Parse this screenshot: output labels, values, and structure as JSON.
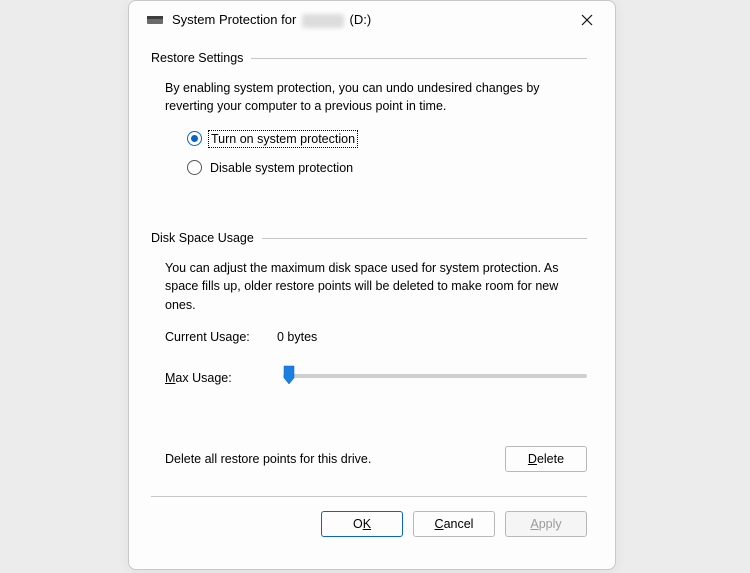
{
  "title": {
    "prefix": "System Protection for",
    "drive_name_obscured": true,
    "drive_letter": "(D:)"
  },
  "restore_settings": {
    "header": "Restore Settings",
    "description": "By enabling system protection, you can undo undesired changes by reverting your computer to a previous point in time.",
    "options": {
      "turn_on": "Turn on system protection",
      "disable": "Disable system protection"
    },
    "selected": "turn_on"
  },
  "disk_usage": {
    "header": "Disk Space Usage",
    "description": "You can adjust the maximum disk space used for system protection. As space fills up, older restore points will be deleted to make room for new ones.",
    "current_usage_label": "Current Usage:",
    "current_usage_value": "0 bytes",
    "max_usage_label_prefix": "M",
    "max_usage_label_rest": "ax Usage:",
    "slider_position_pct": 2
  },
  "delete_section": {
    "text": "Delete all restore points for this drive.",
    "button_prefix": "D",
    "button_rest": "elete"
  },
  "footer": {
    "ok_prefix": "O",
    "ok_rest": "K",
    "cancel_prefix": "C",
    "cancel_rest": "ancel",
    "apply_prefix": "A",
    "apply_rest": "pply",
    "apply_enabled": false
  }
}
